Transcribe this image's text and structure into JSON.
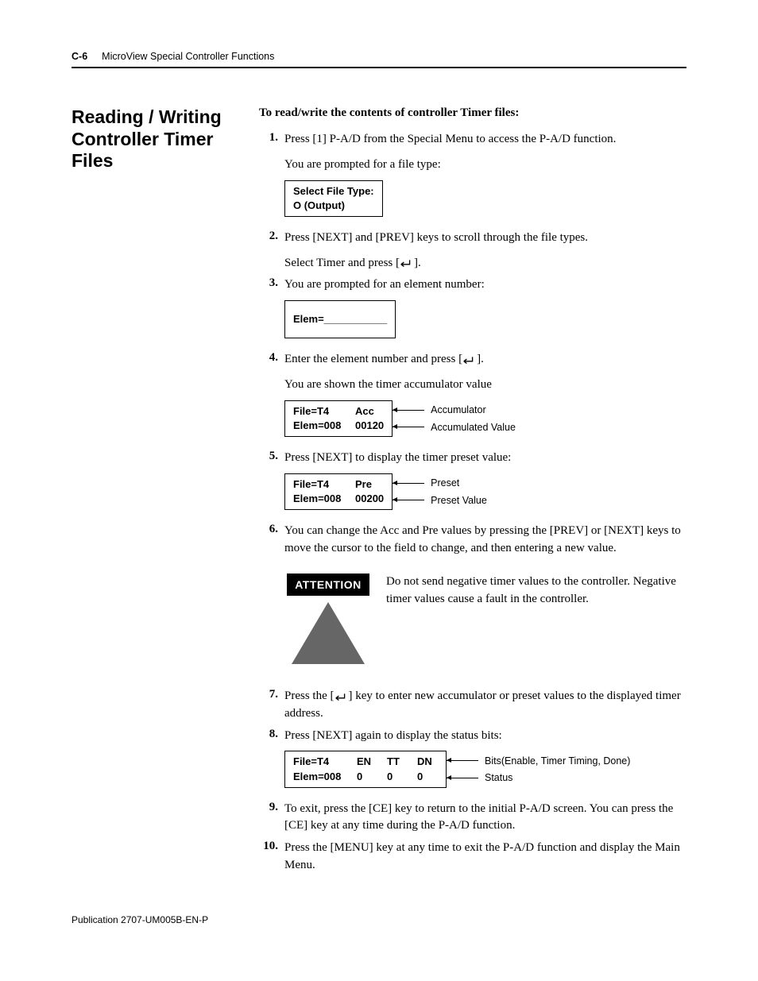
{
  "header": {
    "page_num": "C-6",
    "chapter": "MicroView Special Controller Functions"
  },
  "heading": "Reading / Writing Controller Timer Files",
  "intro": "To read/write the contents of controller Timer files:",
  "steps": {
    "s1a": "Press [1] P-A/D from the Special Menu to access the P-A/D function.",
    "s1b": "You are prompted for a file type:",
    "box1_l1": "Select File Type:",
    "box1_l2": "O (Output)",
    "s2a": "Press [NEXT] and [PREV] keys to scroll through the file types.",
    "s2b_pre": "Select Timer and press [",
    "s2b_post": "].",
    "s3": "You are prompted for an element number:",
    "box2": "Elem=___________",
    "s4a_pre": "Enter the element number and press [",
    "s4a_post": "].",
    "s4b": "You are shown the timer accumulator value",
    "box3_l1a": "File=T4",
    "box3_l1b": "Acc",
    "box3_l2a": "Elem=008",
    "box3_l2b": "00120",
    "cal_accumulator": "Accumulator",
    "cal_accval": "Accumulated Value",
    "s5": "Press [NEXT] to display the timer preset value:",
    "box4_l1a": "File=T4",
    "box4_l1b": "Pre",
    "box4_l2a": "Elem=008",
    "box4_l2b": "00200",
    "cal_preset": "Preset",
    "cal_preval": "Preset Value",
    "s6": "You can change the Acc and Pre values by pressing the [PREV] or [NEXT] keys to move the cursor to the field to change, and then entering a new value.",
    "attn_label": "ATTENTION",
    "attn_text": "Do not send negative timer values to the controller. Negative timer values cause a fault in the controller.",
    "s7_pre": "Press the [",
    "s7_post": "] key to enter new accumulator or preset values to the displayed timer address.",
    "s8": "Press [NEXT] again to display the status bits:",
    "box5_h1": "File=T4",
    "box5_h2": "EN",
    "box5_h3": "TT",
    "box5_h4": "DN",
    "box5_v1": "Elem=008",
    "box5_v2": "0",
    "box5_v3": "0",
    "box5_v4": "0",
    "cal_bits": "Bits(Enable, Timer Timing, Done)",
    "cal_status": "Status",
    "s9": "To exit, press the [CE] key to return to the initial P-A/D screen. You can press the [CE] key at any time during the P-A/D function.",
    "s10": "Press the [MENU] key at any time to exit the P-A/D function and display the Main Menu."
  },
  "footer": "Publication 2707-UM005B-EN-P"
}
